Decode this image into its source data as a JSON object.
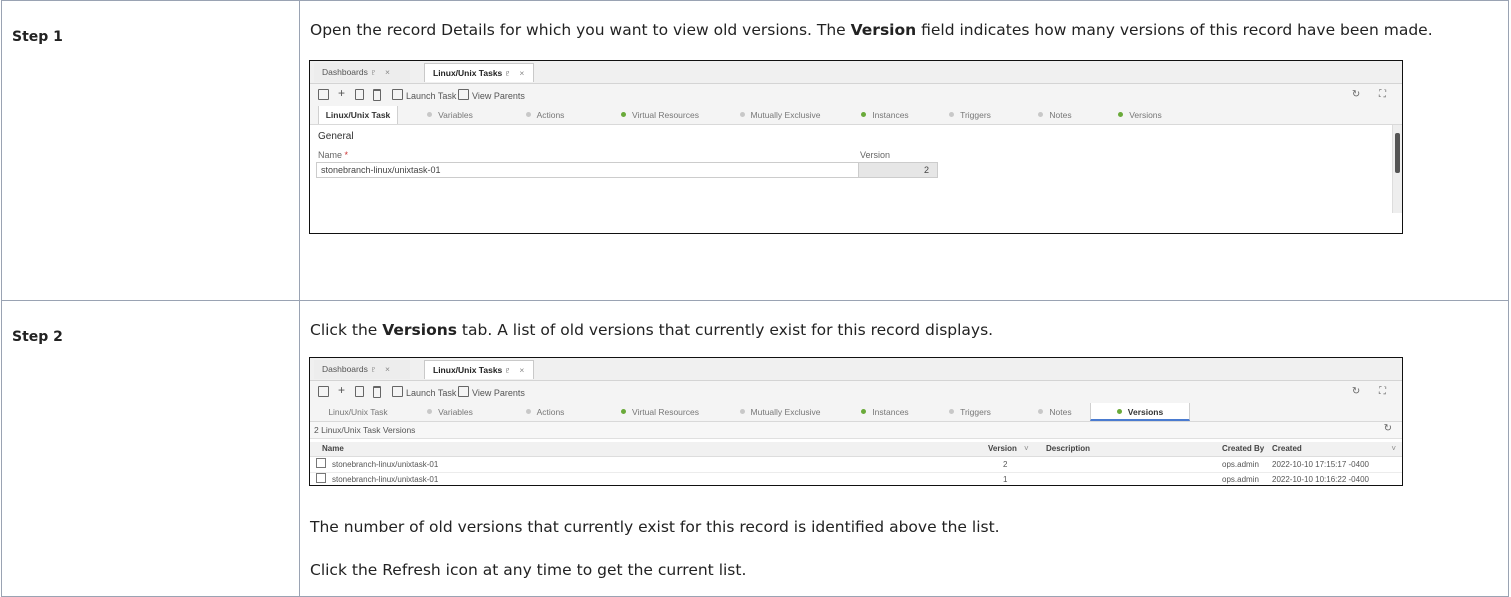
{
  "steps": [
    {
      "label": "Step 1",
      "desc_a": "Open the record Details for which you want to view old versions. The ",
      "desc_bold": "Version",
      "desc_b": " field indicates how many versions of this record have been made."
    },
    {
      "label": "Step 2",
      "desc_a": "Click the ",
      "desc_bold": "Versions",
      "desc_b": " tab. A list of old versions that currently exist for this record displays.",
      "note1": "The number of old versions that currently exist for this record is identified above the list.",
      "note2": "Click the Refresh icon at any time to get the current list."
    }
  ],
  "window_tabs": [
    {
      "label": "Dashboards",
      "pin": "♇",
      "close": "×"
    },
    {
      "label": "Linux/Unix Tasks",
      "pin": "♇",
      "close": "×"
    }
  ],
  "toolbar": {
    "save_icon": "save-icon",
    "add": "+",
    "launch_task": "Launch Task",
    "view_parents": "View Parents",
    "right_icons": "↻ ⛶"
  },
  "record_tabs": [
    {
      "label": "Linux/Unix Task",
      "dot": ""
    },
    {
      "label": "Variables",
      "dot": "gray"
    },
    {
      "label": "Actions",
      "dot": "gray"
    },
    {
      "label": "Virtual Resources",
      "dot": "green"
    },
    {
      "label": "Mutually Exclusive",
      "dot": "gray"
    },
    {
      "label": "Instances",
      "dot": "green"
    },
    {
      "label": "Triggers",
      "dot": "gray"
    },
    {
      "label": "Notes",
      "dot": "gray"
    },
    {
      "label": "Versions",
      "dot": "green"
    }
  ],
  "details": {
    "section": "General",
    "name_label": "Name",
    "required": "*",
    "name_value": "stonebranch-linux/unixtask-01",
    "version_label": "Version",
    "version_value": "2"
  },
  "versions": {
    "count_label": "2 Linux/Unix Task Versions",
    "refresh_icon": "↻",
    "headers": {
      "name": "Name",
      "version": "Version",
      "sort": "˅",
      "description": "Description",
      "created_by": "Created By",
      "created": "Created"
    },
    "rows": [
      {
        "name": "stonebranch-linux/unixtask-01",
        "version": "2",
        "created_by": "ops.admin",
        "created": "2022-10-10 17:15:17 -0400"
      },
      {
        "name": "stonebranch-linux/unixtask-01",
        "version": "1",
        "created_by": "ops.admin",
        "created": "2022-10-10 10:16:22 -0400"
      }
    ]
  }
}
